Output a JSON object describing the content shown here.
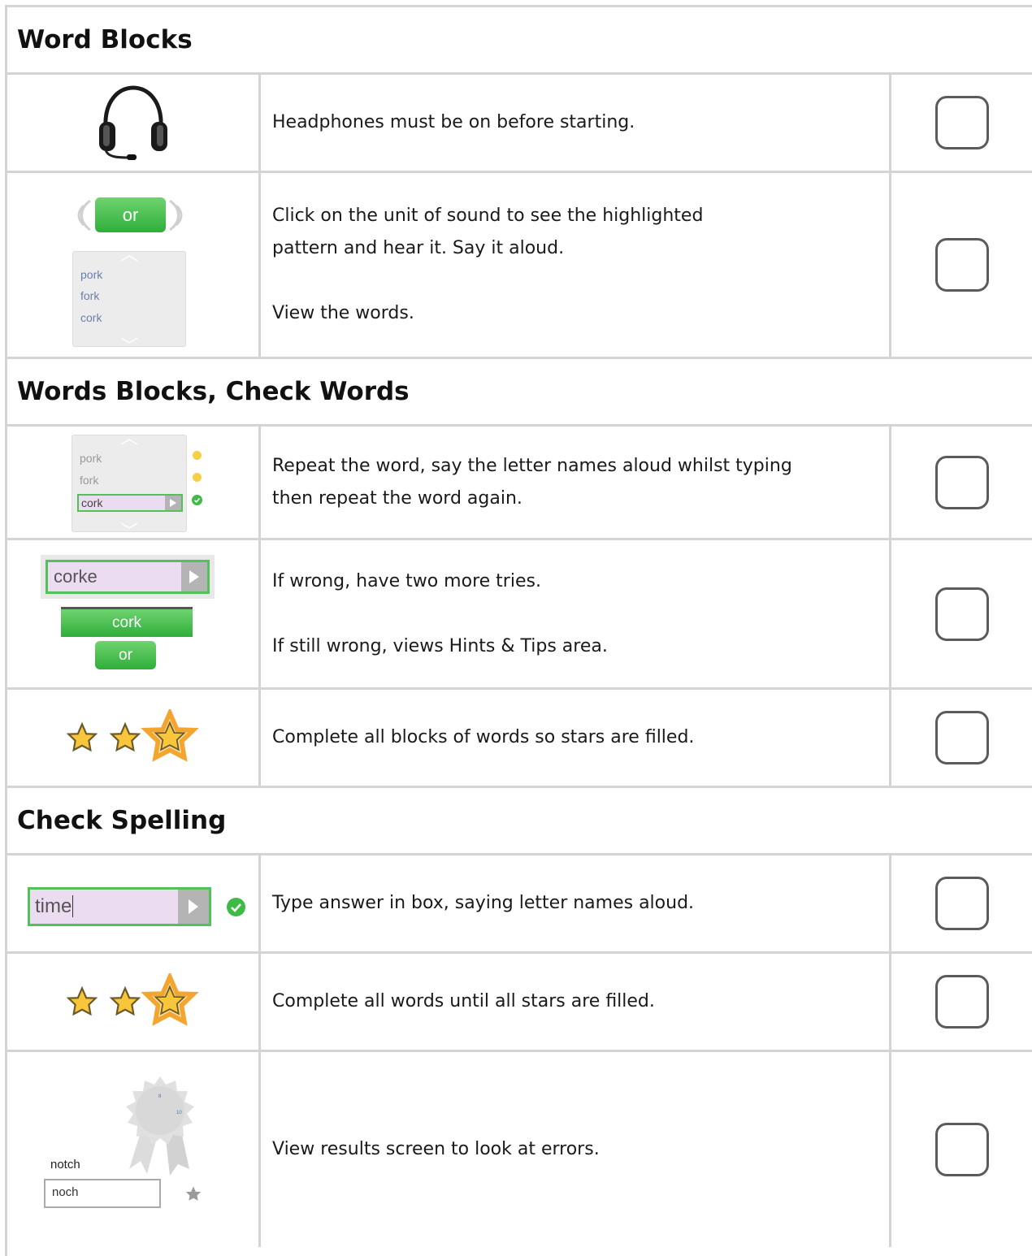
{
  "sections": [
    {
      "title": "Word Blocks",
      "rows": [
        {
          "text": [
            "Headphones must be on before starting."
          ]
        },
        {
          "text": [
            "Click on the unit of sound to see the highlighted pattern and hear it. Say it aloud.",
            "View the words."
          ],
          "illustration": {
            "sound_button": "or",
            "words": [
              "pork",
              "fork",
              "cork"
            ]
          }
        }
      ]
    },
    {
      "title": "Words Blocks, Check Words",
      "rows": [
        {
          "text": [
            "Repeat the word, say the letter names aloud whilst typing then repeat the word again."
          ],
          "illustration": {
            "words": [
              "pork",
              "fork",
              "cork"
            ]
          }
        },
        {
          "text": [
            "If wrong, have two more tries.",
            "If still wrong, views Hints & Tips area."
          ],
          "illustration": {
            "typed": "corke",
            "answer": "cork",
            "sound_button": "or"
          }
        },
        {
          "text": [
            "Complete all blocks of words so stars are filled."
          ]
        }
      ]
    },
    {
      "title": "Check Spelling",
      "rows": [
        {
          "text": [
            "Type answer in box, saying letter names aloud."
          ],
          "illustration": {
            "typed": "time"
          }
        },
        {
          "text": [
            "Complete all words until all stars are filled."
          ]
        },
        {
          "text": [
            "View results screen to look at errors."
          ],
          "illustration": {
            "score_top": "8",
            "score_bottom": "10",
            "target_word": "notch",
            "typed": "noch"
          }
        }
      ]
    }
  ],
  "colors": {
    "border": "#d4d4d4",
    "green": "#3dbb46",
    "star_fill": "#f7c63a",
    "input_bg": "#ecdcf2"
  }
}
